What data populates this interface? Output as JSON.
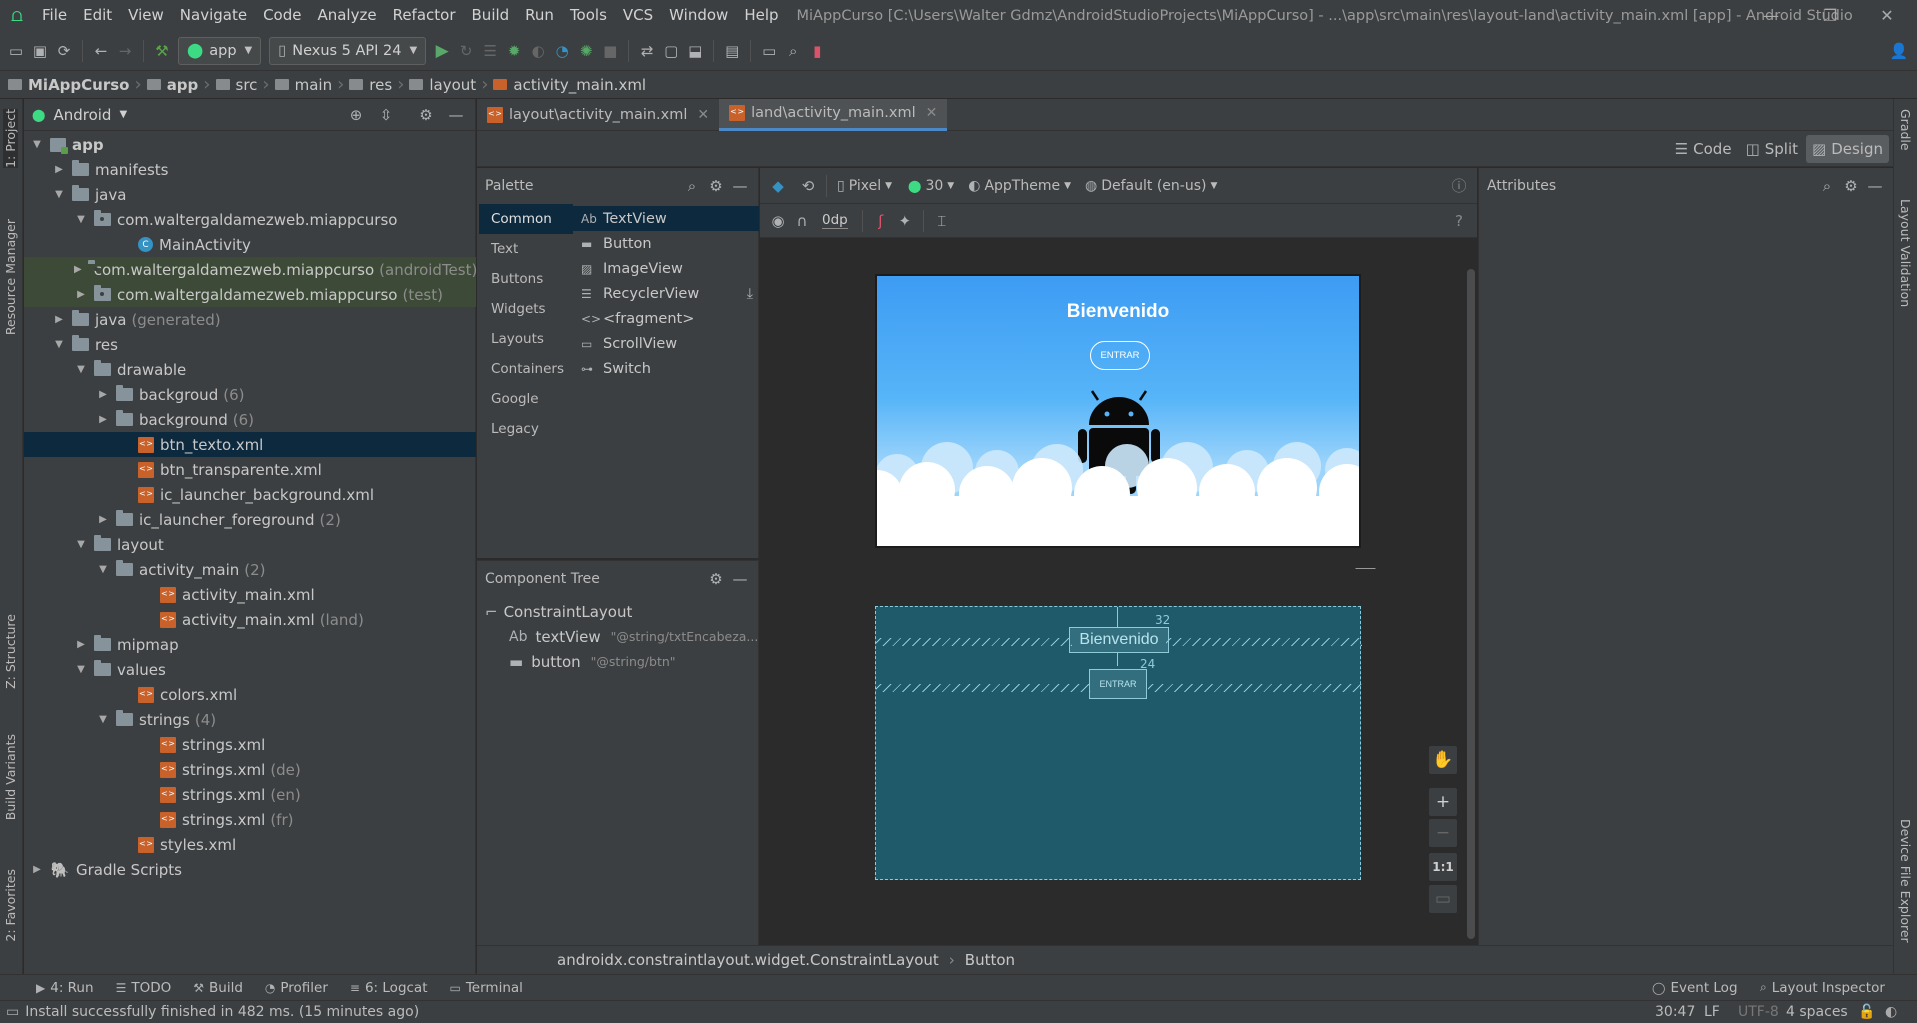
{
  "menu": {
    "items": [
      "File",
      "Edit",
      "View",
      "Navigate",
      "Code",
      "Analyze",
      "Refactor",
      "Build",
      "Run",
      "Tools",
      "VCS",
      "Window",
      "Help"
    ],
    "window_title": "MiAppCurso [C:\\Users\\Walter Gdmz\\AndroidStudioProjects\\MiAppCurso] - ...\\app\\src\\main\\res\\layout-land\\activity_main.xml [app] - Android Studio"
  },
  "toolbar": {
    "run_config": "app",
    "device": "Nexus 5 API 24"
  },
  "breadcrumb": [
    "MiAppCurso",
    "app",
    "src",
    "main",
    "res",
    "layout",
    "activity_main.xml"
  ],
  "project": {
    "view_label": "Android",
    "rows": [
      {
        "label": "app",
        "hint": ""
      },
      {
        "label": "manifests",
        "hint": ""
      },
      {
        "label": "java",
        "hint": ""
      },
      {
        "label": "com.waltergaldamezweb.miappcurso",
        "hint": ""
      },
      {
        "label": "MainActivity",
        "hint": ""
      },
      {
        "label": "com.waltergaldamezweb.miappcurso",
        "hint": "(androidTest)"
      },
      {
        "label": "com.waltergaldamezweb.miappcurso",
        "hint": "(test)"
      },
      {
        "label": "java",
        "hint": "(generated)"
      },
      {
        "label": "res",
        "hint": ""
      },
      {
        "label": "drawable",
        "hint": ""
      },
      {
        "label": "backgroud",
        "hint": "(6)"
      },
      {
        "label": "background",
        "hint": "(6)"
      },
      {
        "label": "btn_texto.xml",
        "hint": ""
      },
      {
        "label": "btn_transparente.xml",
        "hint": ""
      },
      {
        "label": "ic_launcher_background.xml",
        "hint": ""
      },
      {
        "label": "ic_launcher_foreground",
        "hint": "(2)"
      },
      {
        "label": "layout",
        "hint": ""
      },
      {
        "label": "activity_main",
        "hint": "(2)"
      },
      {
        "label": "activity_main.xml",
        "hint": ""
      },
      {
        "label": "activity_main.xml",
        "hint": "(land)"
      },
      {
        "label": "mipmap",
        "hint": ""
      },
      {
        "label": "values",
        "hint": ""
      },
      {
        "label": "colors.xml",
        "hint": ""
      },
      {
        "label": "strings",
        "hint": "(4)"
      },
      {
        "label": "strings.xml",
        "hint": ""
      },
      {
        "label": "strings.xml",
        "hint": "(de)"
      },
      {
        "label": "strings.xml",
        "hint": "(en)"
      },
      {
        "label": "strings.xml",
        "hint": "(fr)"
      },
      {
        "label": "styles.xml",
        "hint": ""
      },
      {
        "label": "Gradle Scripts",
        "hint": ""
      }
    ]
  },
  "left_strip": [
    "1: Project",
    "Resource Manager",
    "Z: Structure",
    "Build Variants",
    "2: Favorites"
  ],
  "right_strip": [
    "Gradle",
    "Layout Validation",
    "Device File Explorer"
  ],
  "tabs": [
    {
      "label": "layout\\activity_main.xml"
    },
    {
      "label": "land\\activity_main.xml"
    }
  ],
  "view_modes": [
    "Code",
    "Split",
    "Design"
  ],
  "palette": {
    "title": "Palette",
    "categories": [
      "Common",
      "Text",
      "Buttons",
      "Widgets",
      "Layouts",
      "Containers",
      "Google",
      "Legacy"
    ],
    "items": [
      "TextView",
      "Button",
      "ImageView",
      "RecyclerView",
      "<fragment>",
      "ScrollView",
      "Switch"
    ],
    "textview_glyph": "Ab"
  },
  "design_toolbar": {
    "device": "Pixel",
    "api": "30",
    "theme": "AppTheme",
    "locale": "Default (en-us)",
    "margin": "0dp"
  },
  "component_tree": {
    "title": "Component Tree",
    "root": "ConstraintLayout",
    "children": [
      {
        "glyph": "Ab",
        "label": "textView",
        "hint": "\"@string/txtEncabeza..."
      },
      {
        "glyph": "",
        "label": "button",
        "hint": "\"@string/btn\""
      }
    ]
  },
  "attributes": {
    "title": "Attributes"
  },
  "preview": {
    "title_text": "Bienvenido",
    "button_text": "ENTRAR",
    "margin_top_1": "32",
    "margin_top_2": "24"
  },
  "zoom": {
    "plus": "+",
    "minus": "−",
    "one_to_one": "1:1"
  },
  "status_path": [
    "androidx.constraintlayout.widget.ConstraintLayout",
    "Button"
  ],
  "bottom_tools": [
    {
      "label": "4: Run"
    },
    {
      "label": "TODO"
    },
    {
      "label": "Build"
    },
    {
      "label": "Profiler"
    },
    {
      "label": "6: Logcat"
    },
    {
      "label": "Terminal"
    }
  ],
  "bottom_tools_right": [
    "Event Log",
    "Layout Inspector"
  ],
  "status_bar": {
    "message": "Install successfully finished in 482 ms. (15 minutes ago)",
    "position": "30:47",
    "line_sep": "LF",
    "encoding": "UTF-8",
    "indent": "4 spaces"
  }
}
